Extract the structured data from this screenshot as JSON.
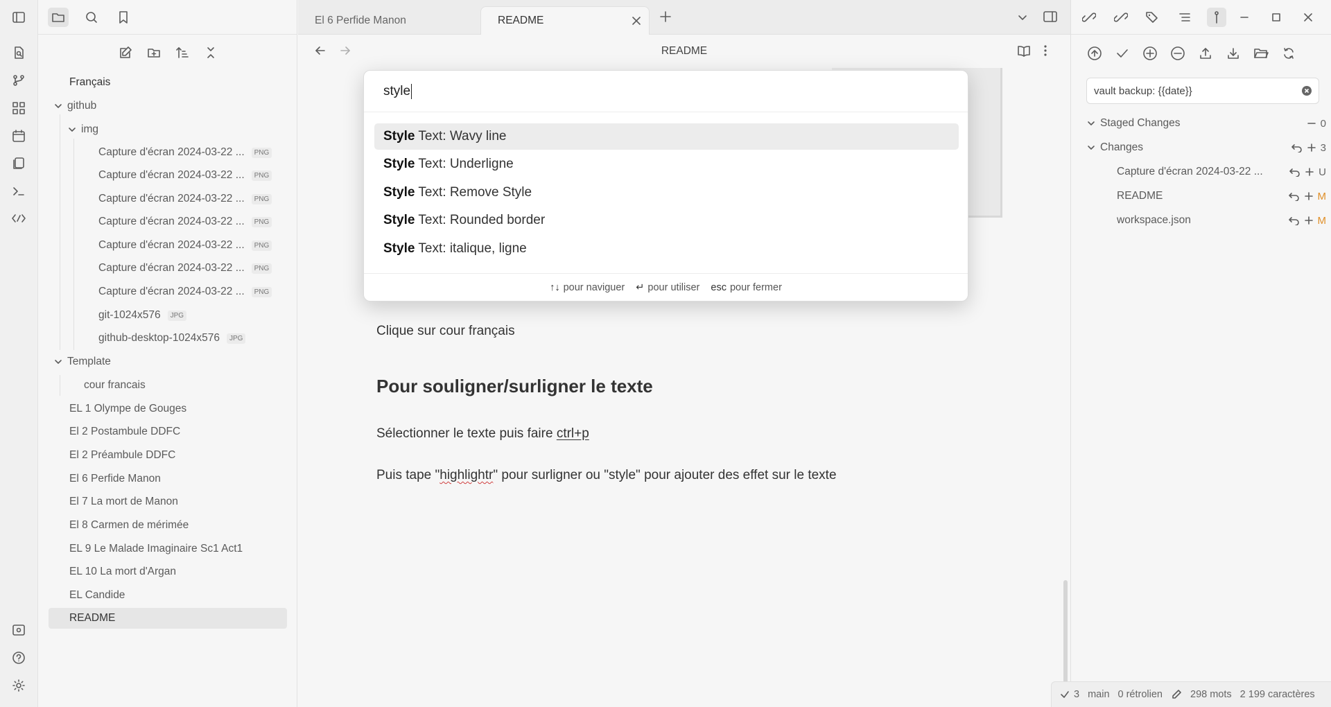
{
  "ribbon": {
    "icons": [
      "sidebar-toggle-icon",
      "quick-switcher-icon",
      "graph-icon",
      "canvas-icon",
      "daily-note-icon",
      "templates-icon",
      "terminal-icon",
      "code-icon",
      "vault-switch-icon",
      "help-icon",
      "settings-icon"
    ]
  },
  "explorer": {
    "root": "Français",
    "items": [
      {
        "label": "github",
        "type": "folder"
      },
      {
        "label": "img",
        "type": "folder"
      },
      {
        "label": "Capture d'écran 2024-03-22 ...",
        "badge": "PNG"
      },
      {
        "label": "Capture d'écran 2024-03-22 ...",
        "badge": "PNG"
      },
      {
        "label": "Capture d'écran 2024-03-22 ...",
        "badge": "PNG"
      },
      {
        "label": "Capture d'écran 2024-03-22 ...",
        "badge": "PNG"
      },
      {
        "label": "Capture d'écran 2024-03-22 ...",
        "badge": "PNG"
      },
      {
        "label": "Capture d'écran 2024-03-22 ...",
        "badge": "PNG"
      },
      {
        "label": "Capture d'écran 2024-03-22 ...",
        "badge": "PNG"
      },
      {
        "label": "git-1024x576",
        "badge": "JPG"
      },
      {
        "label": "github-desktop-1024x576",
        "badge": "JPG"
      },
      {
        "label": "Template",
        "type": "folder"
      },
      {
        "label": "cour francais"
      },
      {
        "label": "EL 1 Olympe de Gouges"
      },
      {
        "label": "El 2 Postambule DDFC"
      },
      {
        "label": "El 2 Préambule DDFC"
      },
      {
        "label": "El 6 Perfide Manon"
      },
      {
        "label": "El 7 La mort de Manon"
      },
      {
        "label": "El 8 Carmen de mérimée"
      },
      {
        "label": "EL 9 Le Malade Imaginaire Sc1 Act1"
      },
      {
        "label": "EL 10 La mort d'Argan"
      },
      {
        "label": "EL Candide"
      },
      {
        "label": "README"
      }
    ]
  },
  "tabs": [
    {
      "label": "El 6 Perfide Manon"
    },
    {
      "label": "README",
      "active": true
    }
  ],
  "editor": {
    "title": "README",
    "line1": "Clique sur cour français",
    "heading": "Pour souligner/surligner le texte",
    "line2_pre": "Sélectionner le texte puis faire ",
    "line2_code": "ctrl+p",
    "line3_a": "Puis tape \"",
    "line3_word": "highlightr",
    "line3_b": "\" pour surligner ou \"style\" pour ajouter des effet sur le texte"
  },
  "palette": {
    "query": "style",
    "suggestions": [
      {
        "bold": "Style",
        "rest": "Text: Wavy line"
      },
      {
        "bold": "Style",
        "rest": "Text: Underligne"
      },
      {
        "bold": "Style",
        "rest": "Text: Remove Style"
      },
      {
        "bold": "Style",
        "rest": "Text: Rounded border"
      },
      {
        "bold": "Style",
        "rest": "Text: italique, ligne"
      }
    ],
    "footer": {
      "nav_key": "↑↓",
      "nav_label": "pour naviguer",
      "use_key": "↵",
      "use_label": "pour utiliser",
      "close_key": "esc",
      "close_label": "pour fermer"
    }
  },
  "git": {
    "commit_message": "vault backup: {{date}}",
    "staged_label": "Staged Changes",
    "staged_count": "0",
    "changes_label": "Changes",
    "changes_count": "3",
    "files": [
      {
        "name": "Capture d'écran 2024-03-22 ...",
        "status": "U"
      },
      {
        "name": "README",
        "status": "M"
      },
      {
        "name": "workspace.json",
        "status": "M"
      }
    ],
    "status_modified_color": "#e0902a"
  },
  "statusbar": {
    "changes": "3",
    "branch": "main",
    "backlinks": "0 rétrolien",
    "words": "298 mots",
    "chars": "2 199 caractères"
  }
}
